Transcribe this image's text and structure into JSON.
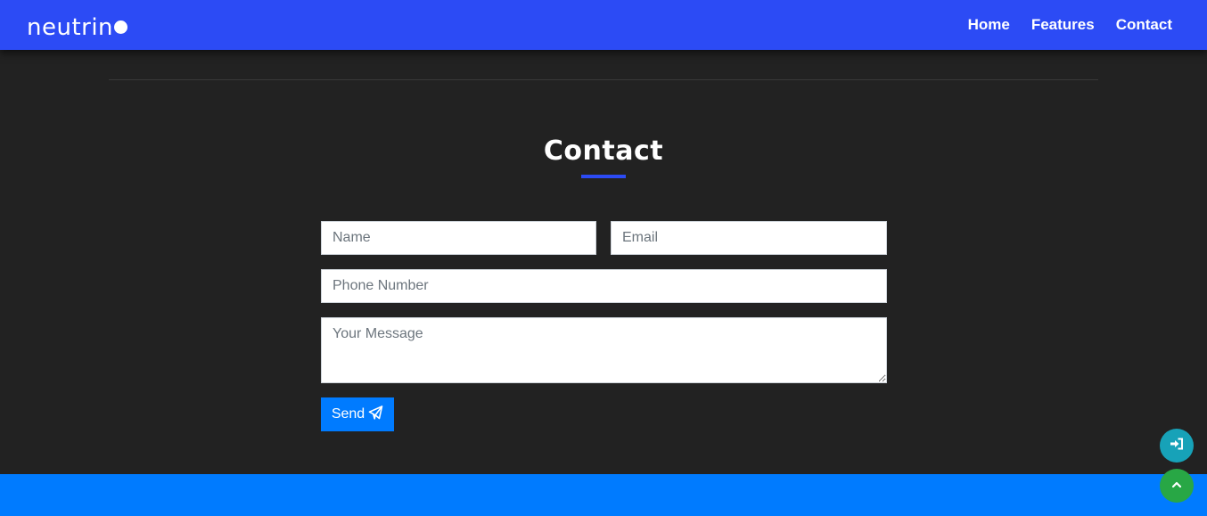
{
  "navbar": {
    "brand": "neutrin",
    "links": [
      {
        "label": "Home"
      },
      {
        "label": "Features"
      },
      {
        "label": "Contact"
      }
    ],
    "colors": {
      "background": "#2c4bf5"
    }
  },
  "contact": {
    "title": "Contact",
    "fields": {
      "name": {
        "placeholder": "Name",
        "value": ""
      },
      "email": {
        "placeholder": "Email",
        "value": ""
      },
      "phone": {
        "placeholder": "Phone Number",
        "value": ""
      },
      "message": {
        "placeholder": "Your Message",
        "value": ""
      }
    },
    "send_button": {
      "label": "Send",
      "icon": "paper-plane-icon"
    }
  },
  "floating_buttons": [
    {
      "icon": "sign-in-icon",
      "color": "#17a2b8"
    },
    {
      "icon": "chevron-up-icon",
      "color": "#28a745"
    }
  ],
  "colors": {
    "page_background": "#222222",
    "accent": "#2c4bf5",
    "primary": "#007bff"
  }
}
